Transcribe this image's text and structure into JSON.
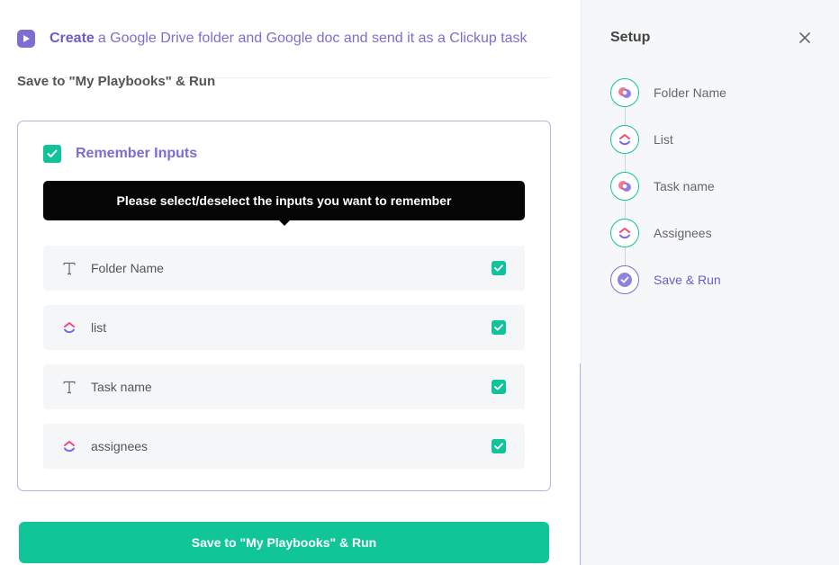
{
  "header": {
    "create_label": "Create",
    "title_rest": "a Google Drive folder and Google doc and send it as a Clickup task"
  },
  "subhead": "Save to \"My Playbooks\" & Run",
  "remember": {
    "label": "Remember Inputs",
    "checked": true
  },
  "tooltip": "Please select/deselect the inputs you want to remember",
  "inputs": [
    {
      "label": "Folder Name",
      "icon": "text-type-icon",
      "checked": true
    },
    {
      "label": "list",
      "icon": "clickup-icon",
      "checked": true
    },
    {
      "label": "Task name",
      "icon": "text-type-icon",
      "checked": true
    },
    {
      "label": "assignees",
      "icon": "clickup-icon",
      "checked": true
    }
  ],
  "run_button": "Save to \"My Playbooks\" & Run",
  "setup": {
    "title": "Setup",
    "steps": [
      {
        "label": "Folder Name",
        "icon": "google-drive-app-icon",
        "status": "done"
      },
      {
        "label": "List",
        "icon": "clickup-icon",
        "status": "done"
      },
      {
        "label": "Task name",
        "icon": "google-drive-app-icon",
        "status": "done"
      },
      {
        "label": "Assignees",
        "icon": "clickup-icon",
        "status": "done"
      },
      {
        "label": "Save & Run",
        "icon": "check-circle-icon",
        "status": "active"
      }
    ]
  },
  "colors": {
    "accent_purple": "#7a6fd0",
    "accent_green": "#10c39a",
    "tooltip_bg": "#050505"
  }
}
